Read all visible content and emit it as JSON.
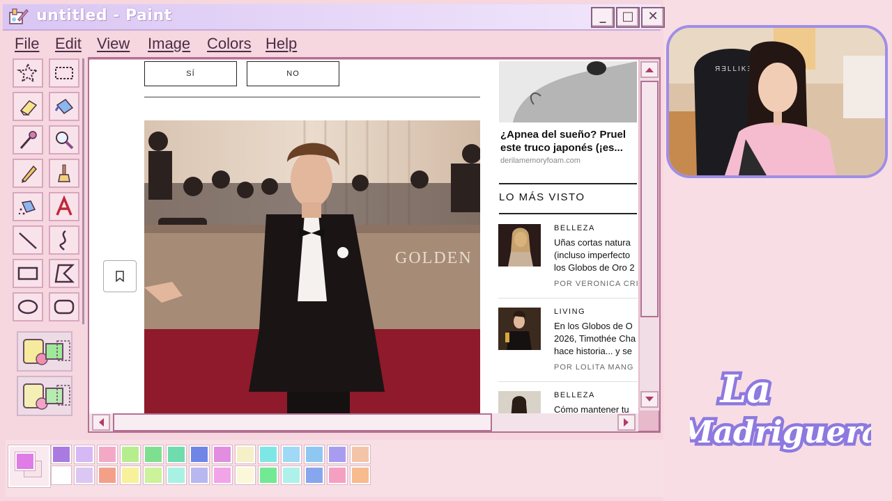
{
  "window": {
    "title": "untitled - Paint",
    "controls": {
      "minimize": "_",
      "maximize": "□",
      "close": "✕"
    }
  },
  "menu": [
    "File",
    "Edit",
    "View",
    "Image",
    "Colors",
    "Help"
  ],
  "tools": [
    "free-select-icon",
    "rect-select-icon",
    "eraser-icon",
    "fill-bucket-icon",
    "color-picker-icon",
    "magnifier-icon",
    "pencil-icon",
    "brush-icon",
    "airbrush-icon",
    "text-icon",
    "line-icon",
    "curve-icon",
    "rectangle-icon",
    "polygon-icon",
    "ellipse-icon",
    "rounded-rect-icon"
  ],
  "article": {
    "vote_yes": "SÍ",
    "vote_no": "NO",
    "photo_sign": "GOLDEN"
  },
  "sidebar": {
    "ad_title_line1": "¿Apnea del sueño? Pruel",
    "ad_title_line2": "este truco japonés (¡es...",
    "ad_source": "derilamemoryfoam.com",
    "section_title": "LO MÁS VISTO",
    "articles": [
      {
        "category": "BELLEZA",
        "title": "Uñas cortas natura\n(incluso imperfecto\nlos Globos de Oro 2",
        "author": "POR VERONICA CRIS"
      },
      {
        "category": "LIVING",
        "title": "En los Globos de O\n2026, Timothée Cha\nhace historia... y se",
        "author": "POR LOLITA MANG"
      },
      {
        "category": "BELLEZA",
        "title": "Cómo mantener tu",
        "author": ""
      }
    ]
  },
  "palette": {
    "primary": "#e07ce6",
    "secondary": "#f9e3ea",
    "row1": [
      "#a97be0",
      "#d6b8f5",
      "#f3a9c6",
      "#b6ee8e",
      "#7ee08f",
      "#6fdcae",
      "#6f86e6",
      "#e28de0",
      "#f5f0c8",
      "#7fe6e6",
      "#9fd9f5",
      "#8fc7f3",
      "#a89cf0",
      "#f4c4a8"
    ],
    "row2": [
      "#ffffff",
      "#dcc6f3",
      "#f4a089",
      "#f6f19a",
      "#ccf29a",
      "#a9f2e3",
      "#b8b7f0",
      "#f2a4e9",
      "#fbf7d9",
      "#72ea94",
      "#aef1ea",
      "#86a6ee",
      "#f5a0c3",
      "#f7bb8e"
    ]
  },
  "overlay": {
    "logo_line1": "La",
    "logo_line2": "Madriguera"
  }
}
